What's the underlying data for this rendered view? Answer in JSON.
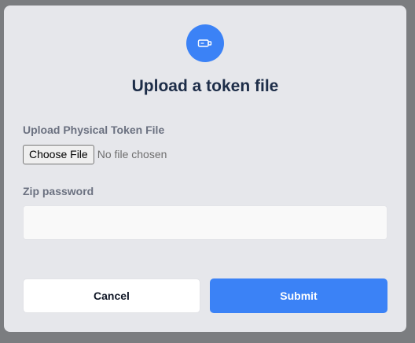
{
  "modal": {
    "title": "Upload a token file",
    "icon": "token-device-icon",
    "accent_color": "#3b82f6"
  },
  "file_field": {
    "label": "Upload Physical Token File",
    "button_label": "Choose File",
    "status": "No file chosen"
  },
  "zip_field": {
    "label": "Zip password",
    "value": "",
    "placeholder": ""
  },
  "actions": {
    "cancel_label": "Cancel",
    "submit_label": "Submit"
  }
}
